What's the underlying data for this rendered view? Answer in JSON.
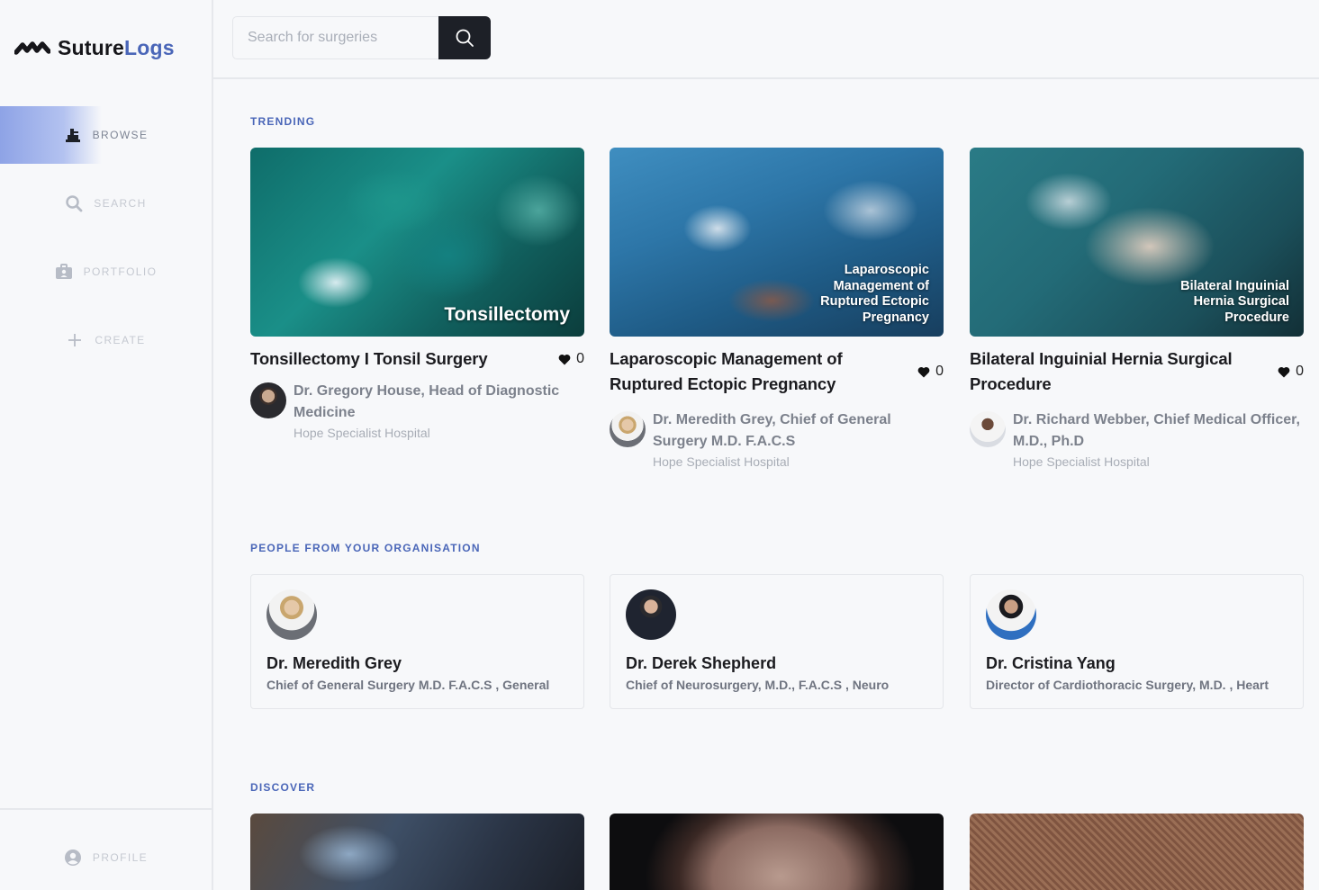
{
  "app": {
    "name_part1": "Suture",
    "name_part2": "Logs"
  },
  "sidebar": {
    "items": [
      {
        "label": "BROWSE",
        "icon": "browse-icon"
      },
      {
        "label": "SEARCH",
        "icon": "search-icon"
      },
      {
        "label": "PORTFOLIO",
        "icon": "portfolio-icon"
      },
      {
        "label": "CREATE",
        "icon": "plus-icon"
      }
    ],
    "profile": {
      "label": "PROFILE",
      "icon": "user-circle-icon"
    }
  },
  "search": {
    "placeholder": "Search for surgeries",
    "value": ""
  },
  "sections": {
    "trending": "TRENDING",
    "people": "PEOPLE FROM YOUR ORGANISATION",
    "discover": "DISCOVER"
  },
  "trending": [
    {
      "thumb_caption": "Tonsillectomy",
      "title": "Tonsillectomy I Tonsil Surgery",
      "likes": "0",
      "author": "Dr. Gregory House, Head of Diagnostic Medicine",
      "org": "Hope Specialist Hospital"
    },
    {
      "thumb_caption": "Laparoscopic Management of Ruptured Ectopic Pregnancy",
      "title": "Laparoscopic Management of Ruptured Ectopic Pregnancy",
      "likes": "0",
      "author": "Dr. Meredith Grey, Chief of General Surgery M.D. F.A.C.S",
      "org": "Hope Specialist Hospital"
    },
    {
      "thumb_caption": "Bilateral Inguinial Hernia Surgical Procedure",
      "title": "Bilateral Inguinial Hernia Surgical Procedure",
      "likes": "0",
      "author": "Dr. Richard Webber, Chief Medical Officer, M.D., Ph.D",
      "org": "Hope Specialist Hospital"
    }
  ],
  "people": [
    {
      "name": "Dr. Meredith Grey",
      "role": "Chief of General Surgery M.D. F.A.C.S , General"
    },
    {
      "name": "Dr. Derek Shepherd",
      "role": "Chief of Neurosurgery, M.D., F.A.C.S , Neuro"
    },
    {
      "name": "Dr. Cristina Yang",
      "role": "Director of Cardiothoracic Surgery, M.D. , Heart"
    }
  ],
  "colors": {
    "accent": "#4a66b8",
    "dark": "#1d2027",
    "muted": "#7c818c"
  }
}
